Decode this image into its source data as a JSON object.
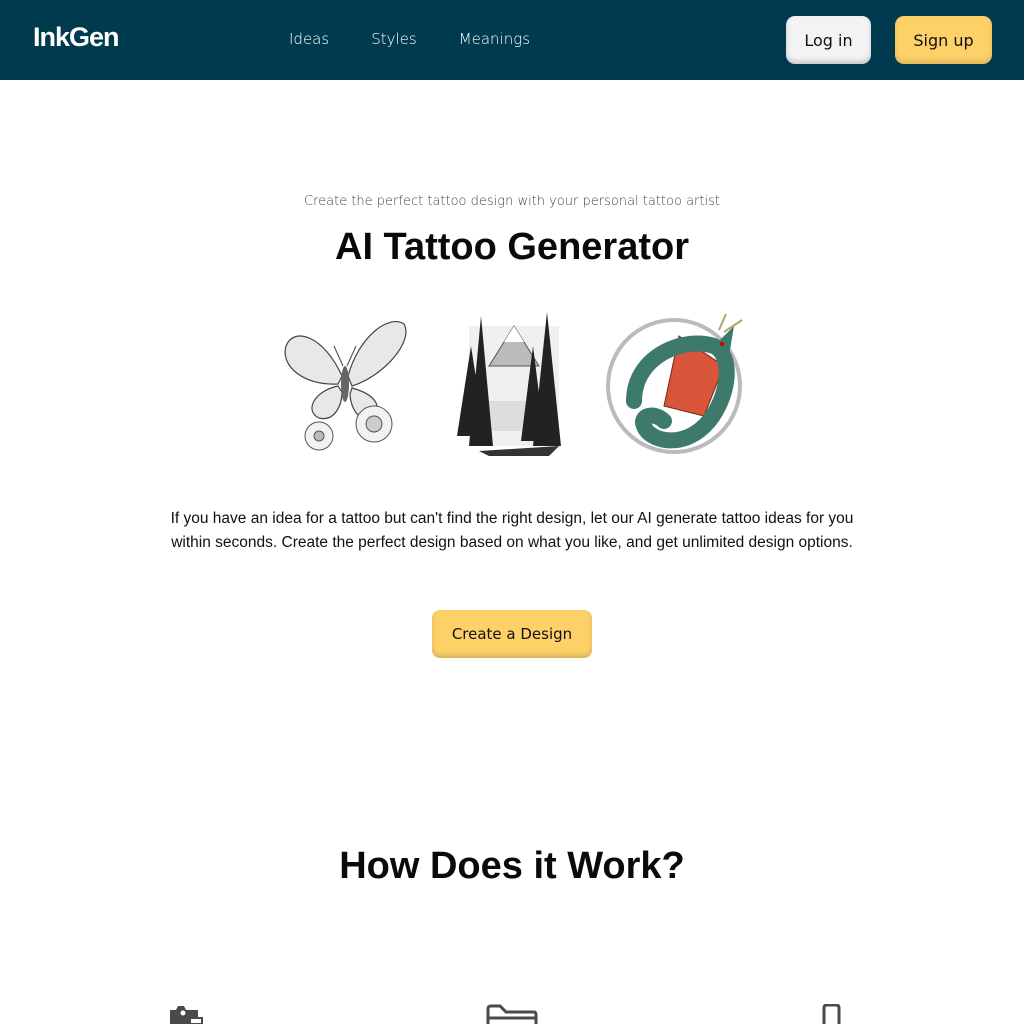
{
  "navbar": {
    "logo": "InkGen",
    "links": [
      {
        "label": "Ideas"
      },
      {
        "label": "Styles"
      },
      {
        "label": "Meanings"
      }
    ],
    "login_label": "Log in",
    "signup_label": "Sign up",
    "background_color": "#003a4f",
    "accent_color": "#fdd068"
  },
  "hero": {
    "subtitle": "Create the perfect tattoo design with your personal tattoo artist",
    "title": "AI Tattoo Generator",
    "gallery": [
      {
        "icon": "butterfly-flower-tattoo-image"
      },
      {
        "icon": "forest-mountain-tattoo-image"
      },
      {
        "icon": "dragon-tattoo-image"
      }
    ],
    "description": "If you have an idea for a tattoo but can't find the right design, let our AI generate tattoo ideas for you within seconds. Create the perfect design based on what you like, and get unlimited design options.",
    "cta_label": "Create a Design"
  },
  "how_it_works": {
    "title": "How Does it Work?",
    "steps": [
      {
        "icon": "camera-image-icon"
      },
      {
        "icon": "folder-icon"
      },
      {
        "icon": "phone-icon"
      }
    ]
  }
}
